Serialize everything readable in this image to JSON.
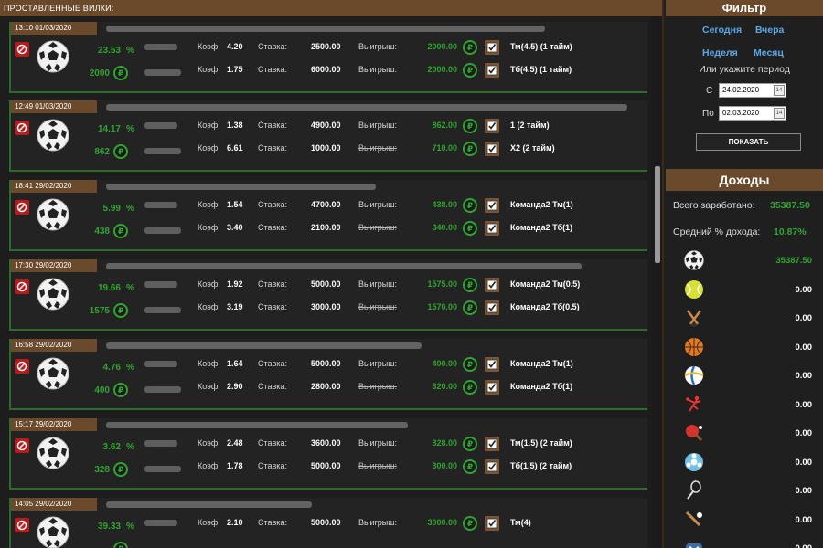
{
  "left_header": "ПРОСТАВЛЕННЫЕ ВИЛКИ:",
  "labels": {
    "coef": "Коэф:",
    "stake": "Ставка:",
    "win": "Выигрыш:"
  },
  "rub_symbol": "₽",
  "cards": [
    {
      "date": "13:10 01/03/2020",
      "pct": "23.53",
      "pct_sign": "%",
      "profit": "2000",
      "rows": [
        {
          "coef": "4.20",
          "stake": "2500.00",
          "win_label_strike": false,
          "win": "2000.00",
          "bet": "Тм(4.5) (1 тайм)"
        },
        {
          "coef": "1.75",
          "stake": "6000.00",
          "win_label_strike": false,
          "win": "2000.00",
          "bet": "Тб(4.5) (1 тайм)"
        }
      ]
    },
    {
      "date": "12:49 01/03/2020",
      "pct": "14.17",
      "pct_sign": "%",
      "profit": "862",
      "rows": [
        {
          "coef": "1.38",
          "stake": "4900.00",
          "win_label_strike": false,
          "win": "862.00",
          "bet": "1 (2 тайм)"
        },
        {
          "coef": "6.61",
          "stake": "1000.00",
          "win_label_strike": true,
          "win": "710.00",
          "bet": "Х2 (2 тайм)"
        }
      ]
    },
    {
      "date": "18:41 29/02/2020",
      "pct": "5.99",
      "pct_sign": "%",
      "profit": "438",
      "rows": [
        {
          "coef": "1.54",
          "stake": "4700.00",
          "win_label_strike": false,
          "win": "438.00",
          "bet": "Команда2 Тм(1)"
        },
        {
          "coef": "3.40",
          "stake": "2100.00",
          "win_label_strike": true,
          "win": "340.00",
          "bet": "Команда2 Тб(1)"
        }
      ]
    },
    {
      "date": "17:30 29/02/2020",
      "pct": "19.66",
      "pct_sign": "%",
      "profit": "1575",
      "rows": [
        {
          "coef": "1.92",
          "stake": "5000.00",
          "win_label_strike": false,
          "win": "1575.00",
          "bet": "Команда2 Тм(0.5)"
        },
        {
          "coef": "3.19",
          "stake": "3000.00",
          "win_label_strike": true,
          "win": "1570.00",
          "bet": "Команда2 Тб(0.5)"
        }
      ]
    },
    {
      "date": "16:58 29/02/2020",
      "pct": "4.76",
      "pct_sign": "%",
      "profit": "400",
      "rows": [
        {
          "coef": "1.64",
          "stake": "5000.00",
          "win_label_strike": false,
          "win": "400.00",
          "bet": "Команда2 Тм(1)"
        },
        {
          "coef": "2.90",
          "stake": "2800.00",
          "win_label_strike": true,
          "win": "320.00",
          "bet": "Команда2 Тб(1)"
        }
      ]
    },
    {
      "date": "15:17 29/02/2020",
      "pct": "3.62",
      "pct_sign": "%",
      "profit": "328",
      "rows": [
        {
          "coef": "2.48",
          "stake": "3600.00",
          "win_label_strike": false,
          "win": "328.00",
          "bet": "Тм(1.5) (2 тайм)"
        },
        {
          "coef": "1.78",
          "stake": "5000.00",
          "win_label_strike": true,
          "win": "300.00",
          "bet": "Тб(1.5) (2 тайм)"
        }
      ]
    },
    {
      "date": "14:05 29/02/2020",
      "pct": "39.33",
      "pct_sign": "%",
      "profit": "",
      "rows": [
        {
          "coef": "2.10",
          "stake": "5000.00",
          "win_label_strike": false,
          "win": "3000.00",
          "bet": "Тм(4)"
        }
      ]
    }
  ],
  "filter": {
    "title": "Фильтр",
    "today": "Сегодня",
    "yesterday": "Вчера",
    "week": "Неделя",
    "month": "Месяц",
    "period_text": "Или укажите период",
    "from_label": "С",
    "from_value": "24.02.2020",
    "to_label": "По",
    "to_value": "02.03.2020",
    "show_button": "ПОКАЗАТЬ"
  },
  "income": {
    "title": "Доходы",
    "total_label": "Всего заработано:",
    "total_value": "35387.50",
    "avg_label": "Средний % дохода:",
    "avg_value": "10.87%",
    "sports": [
      {
        "icon": "soccer-ball-icon",
        "value": "35387.50",
        "highlight": true
      },
      {
        "icon": "tennis-ball-icon",
        "value": "0.00",
        "highlight": false
      },
      {
        "icon": "hockey-icon",
        "value": "0.00",
        "highlight": false
      },
      {
        "icon": "basketball-icon",
        "value": "0.00",
        "highlight": false
      },
      {
        "icon": "volleyball-icon",
        "value": "0.00",
        "highlight": false
      },
      {
        "icon": "handball-icon",
        "value": "0.00",
        "highlight": false
      },
      {
        "icon": "table-tennis-icon",
        "value": "0.00",
        "highlight": false
      },
      {
        "icon": "futsal-icon",
        "value": "0.00",
        "highlight": false
      },
      {
        "icon": "badminton-icon",
        "value": "0.00",
        "highlight": false
      },
      {
        "icon": "baseball-icon",
        "value": "0.00",
        "highlight": false
      },
      {
        "icon": "esports-icon",
        "value": "0.00",
        "highlight": false
      }
    ]
  },
  "colors": {
    "accent_brown": "#6b4a2b",
    "green": "#2fa52f",
    "link_blue": "#5aa8e8",
    "ban_red": "#b71c1c"
  }
}
